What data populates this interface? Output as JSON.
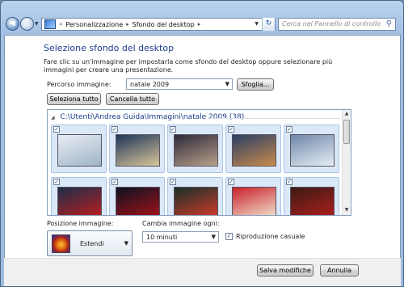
{
  "window": {
    "address": {
      "crumbs": [
        "Personalizzazione",
        "Sfondo del desktop"
      ]
    },
    "search_placeholder": "Cerca nel Pannello di controllo"
  },
  "content": {
    "heading": "Selezione sfondo del desktop",
    "description": "Fare clic su un'immagine per impostarla come sfondo del desktop oppure selezionare più immagini per creare una presentazione.",
    "path_label": "Percorso immagine:",
    "path_value": "natale 2009",
    "browse_label": "Sfoglia...",
    "select_all_label": "Seleziona tutto",
    "clear_all_label": "Cancella tutto",
    "group_header": "C:\\Utenti\\Andrea Guida\\Immagini\\natale 2009 (38)",
    "position_label": "Posizione immagine:",
    "position_value": "Estendi",
    "change_label": "Cambia immagine ogni:",
    "change_value": "10 minuti",
    "shuffle_label": "Riproduzione casuale",
    "shuffle_checked": true
  },
  "thumbnails": [
    {
      "checked": true,
      "colors": [
        "#e9eef5",
        "#9fb3c7"
      ]
    },
    {
      "checked": true,
      "colors": [
        "#1e3558",
        "#d9c69a"
      ]
    },
    {
      "checked": true,
      "colors": [
        "#2d2a3a",
        "#b9a08a"
      ]
    },
    {
      "checked": true,
      "colors": [
        "#2b3f66",
        "#c98a4b"
      ]
    },
    {
      "checked": true,
      "colors": [
        "#6f86a8",
        "#e6eef5"
      ]
    },
    {
      "checked": true,
      "colors": [
        "#1b2e4a",
        "#c11e1e"
      ]
    },
    {
      "checked": true,
      "colors": [
        "#0d1220",
        "#a8121a"
      ]
    },
    {
      "checked": true,
      "colors": [
        "#173028",
        "#d73b2a"
      ]
    },
    {
      "checked": true,
      "colors": [
        "#c8202a",
        "#f3e7d2"
      ]
    },
    {
      "checked": true,
      "colors": [
        "#3a1a14",
        "#b3201e"
      ]
    }
  ],
  "footer": {
    "save_label": "Salva modifiche",
    "cancel_label": "Annulla"
  }
}
